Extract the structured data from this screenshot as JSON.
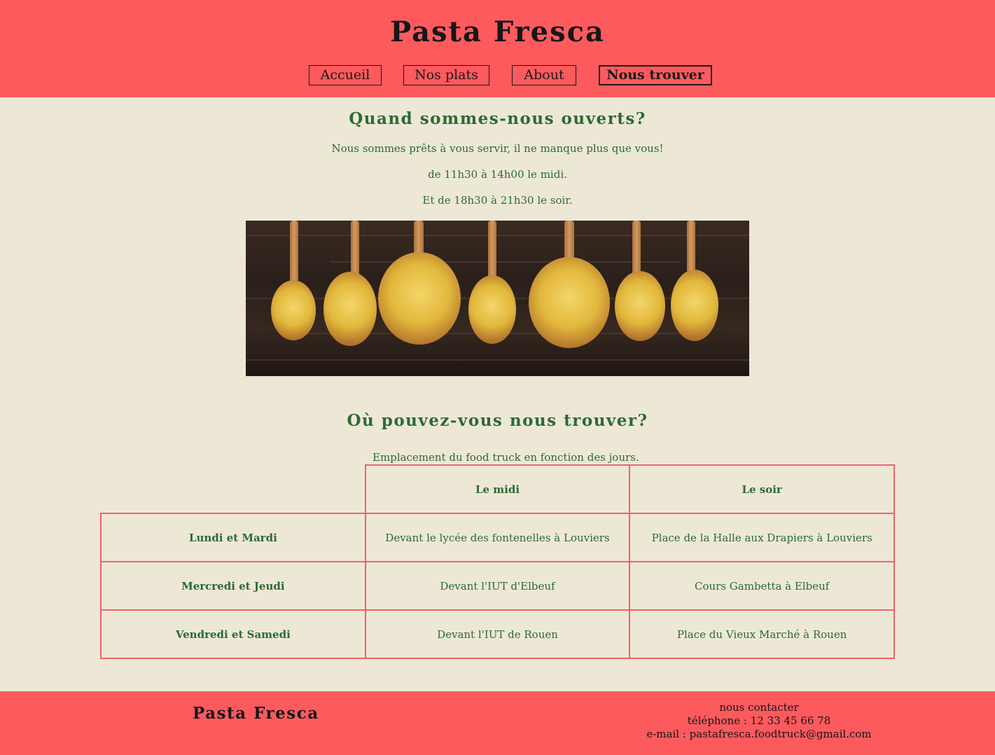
{
  "header": {
    "title": "Pasta Fresca",
    "nav": [
      {
        "label": "Accueil"
      },
      {
        "label": "Nos plats"
      },
      {
        "label": "About"
      },
      {
        "label": "Nous trouver"
      }
    ]
  },
  "hours": {
    "heading": "Quand sommes-nous ouverts?",
    "lines": [
      "Nous sommes prêts à vous servir, il ne manque plus que vous!",
      "de 11h30 à 14h00 le midi.",
      "Et de 18h30 à 21h30 le soir."
    ]
  },
  "location": {
    "heading": "Où pouvez-vous nous trouver?",
    "caption": "Emplacement du food truck en fonction des jours.",
    "columns": [
      "",
      "Le midi",
      "Le soir"
    ],
    "rows": [
      {
        "day": "Lundi et Mardi",
        "midi": "Devant le lycée des fontenelles à Louviers",
        "soir": "Place de la Halle aux Drapiers à Louviers"
      },
      {
        "day": "Mercredi et Jeudi",
        "midi": "Devant l'IUT d'Elbeuf",
        "soir": "Cours Gambetta à Elbeuf"
      },
      {
        "day": "Vendredi et Samedi",
        "midi": "Devant l'IUT de Rouen",
        "soir": "Place du Vieux Marché à Rouen"
      }
    ]
  },
  "footer": {
    "title": "Pasta Fresca",
    "contact_heading": "nous contacter",
    "phone": "téléphone : 12 33 45 66 78",
    "email": "e-mail : pastafresca.foodtruck@gmail.com"
  },
  "colors": {
    "header_bg": "#fd5a5e",
    "page_bg": "#ede8d6",
    "text_green": "#2d6a33",
    "table_border": "#f06468"
  }
}
